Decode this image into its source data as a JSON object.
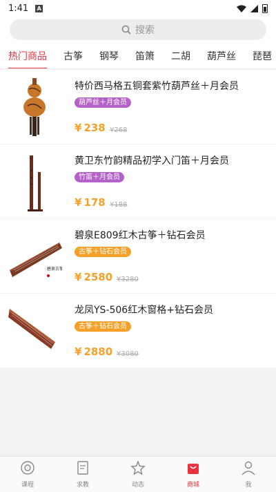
{
  "status": {
    "time": "1:41",
    "notif": "A"
  },
  "search": {
    "placeholder": "搜索"
  },
  "tabs": [
    "热门商品",
    "古筝",
    "钢琴",
    "笛箫",
    "二胡",
    "葫芦丝",
    "琵琶"
  ],
  "active_tab": 0,
  "products": [
    {
      "title": "特价西马格五铜套紫竹葫芦丝＋月会员",
      "tag": "葫芦丝＋月会员",
      "tag_color": "#b462c9",
      "price": "238",
      "original": "268",
      "currency": "¥",
      "thumb": "hulusi"
    },
    {
      "title": "黄卫东竹韵精品初学入门笛＋月会员",
      "tag": "竹笛＋月会员",
      "tag_color": "#b462c9",
      "price": "178",
      "original": "188",
      "currency": "¥",
      "thumb": "flute"
    },
    {
      "title": "碧泉E809红木古筝＋钻石会员",
      "tag": "古筝＋钻石会员",
      "tag_color": "#f5a028",
      "price": "2580",
      "original": "3280",
      "currency": "¥",
      "thumb": "guzheng"
    },
    {
      "title": "龙凤YS-506红木窗格+钻石会员",
      "tag": "古筝＋钻石会员",
      "tag_color": "#f5a028",
      "price": "2880",
      "original": "3080",
      "currency": "¥",
      "thumb": "guzheng2"
    }
  ],
  "nav": [
    {
      "label": "课程",
      "icon": "course-icon"
    },
    {
      "label": "求教",
      "icon": "ask-icon"
    },
    {
      "label": "动态",
      "icon": "star-icon"
    },
    {
      "label": "商城",
      "icon": "shop-bag-icon"
    },
    {
      "label": "我",
      "icon": "person-icon"
    }
  ],
  "active_nav": 3,
  "colors": {
    "accent": "#e8343f",
    "price": "#f5a028",
    "purple_tag": "#b462c9"
  }
}
